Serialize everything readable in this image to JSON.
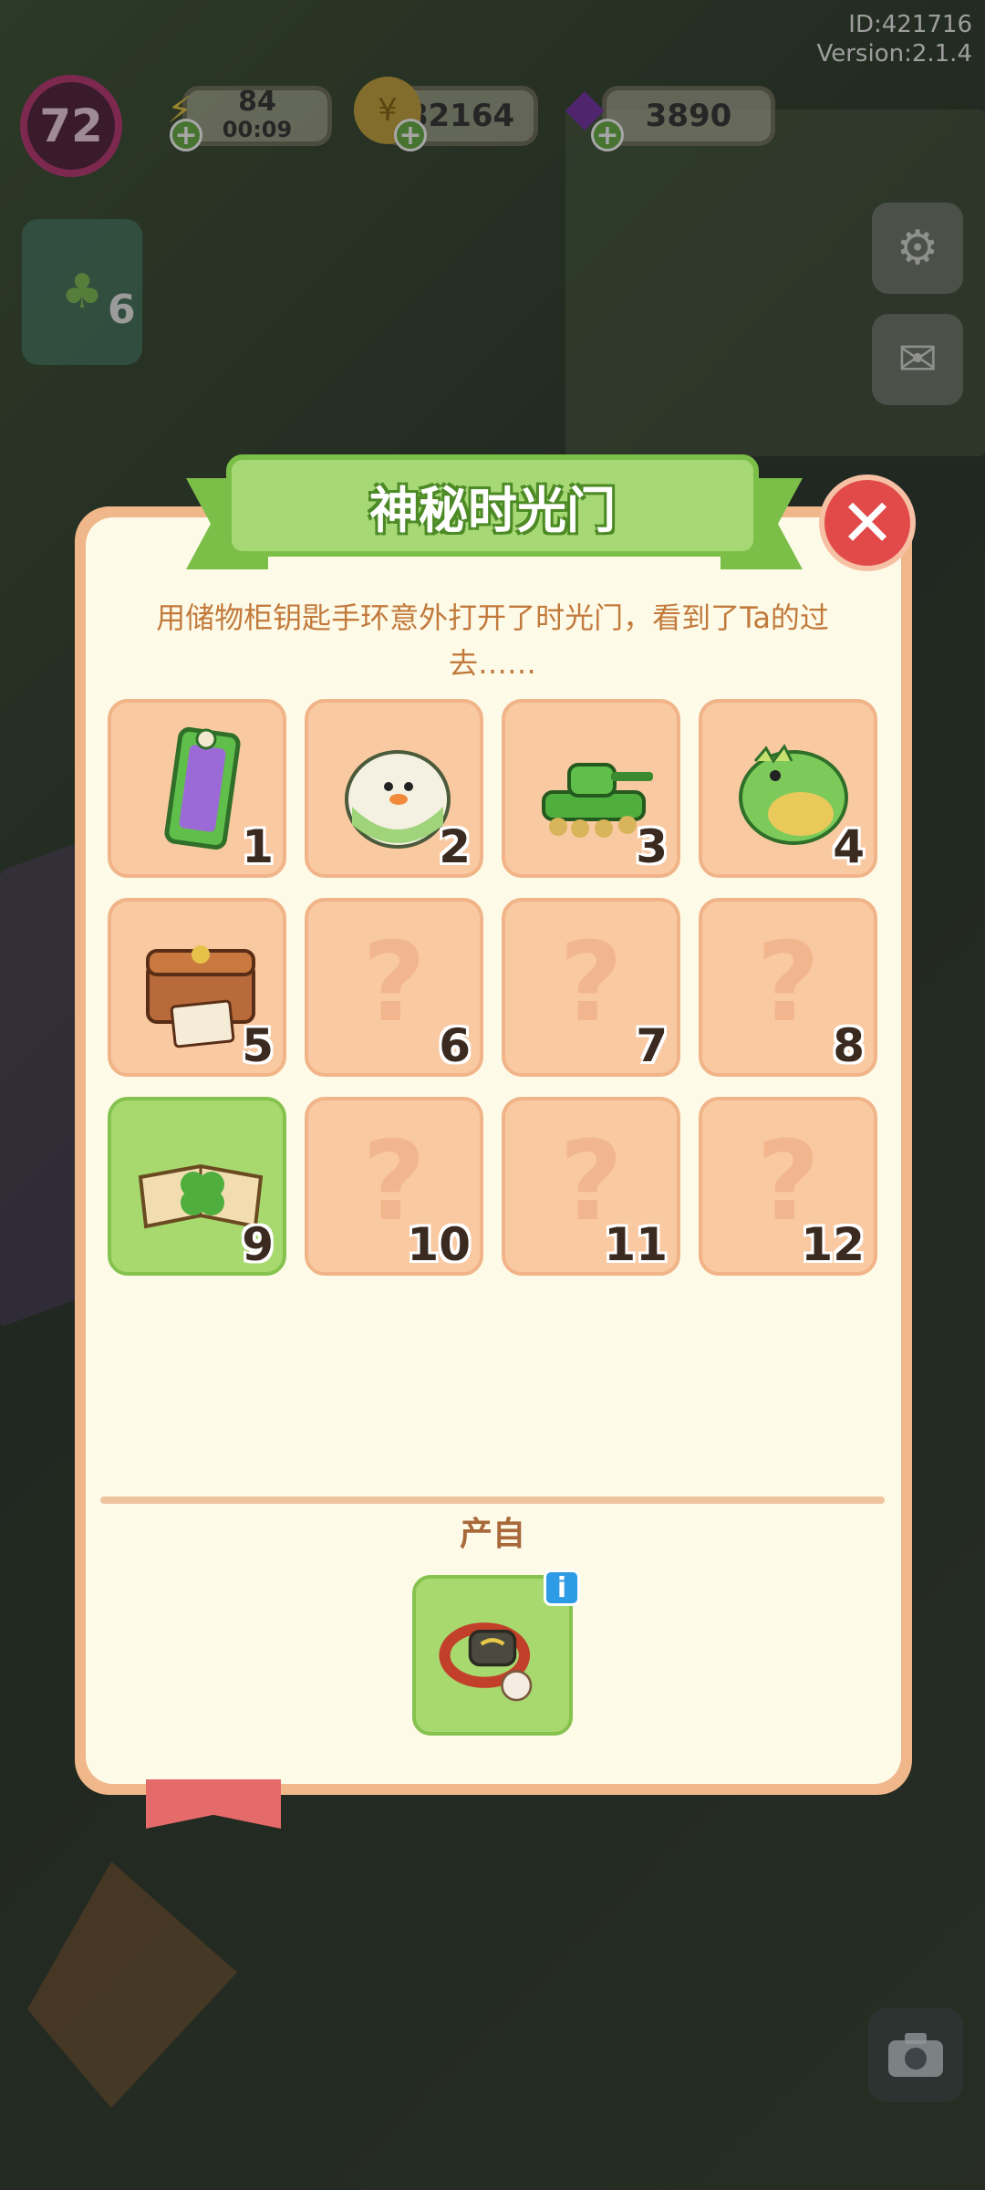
{
  "hud": {
    "id_text": "ID:421716",
    "version_text": "Version:2.1.4",
    "level": "72",
    "energy_value": "84",
    "energy_timer": "00:09",
    "coins": "82164",
    "gems": "3890",
    "side_counter": "6"
  },
  "modal": {
    "title": "神秘时光门",
    "description": "用储物柜钥匙手环意外打开了时光门，看到了Ta的过去……",
    "source_label": "产自",
    "close_icon": "close-icon",
    "items": [
      {
        "num": "1",
        "unlocked": true,
        "icon": "mirror-cabinet-icon"
      },
      {
        "num": "2",
        "unlocked": true,
        "icon": "duck-egg-icon"
      },
      {
        "num": "3",
        "unlocked": true,
        "icon": "toy-tank-icon"
      },
      {
        "num": "4",
        "unlocked": true,
        "icon": "dino-bag-icon"
      },
      {
        "num": "5",
        "unlocked": true,
        "icon": "treasure-chest-icon"
      },
      {
        "num": "6",
        "unlocked": false,
        "icon": "question-mark-icon"
      },
      {
        "num": "7",
        "unlocked": false,
        "icon": "question-mark-icon"
      },
      {
        "num": "8",
        "unlocked": false,
        "icon": "question-mark-icon"
      },
      {
        "num": "9",
        "unlocked": true,
        "selected": true,
        "icon": "clover-book-icon"
      },
      {
        "num": "10",
        "unlocked": false,
        "icon": "question-mark-icon"
      },
      {
        "num": "11",
        "unlocked": false,
        "icon": "question-mark-icon"
      },
      {
        "num": "12",
        "unlocked": false,
        "icon": "question-mark-icon"
      }
    ],
    "question_mark": "?",
    "source_icon": "locker-key-bracelet-icon",
    "info_badge": "i"
  },
  "colors": {
    "panel_border": "#f0b78a",
    "panel_fill": "#fdfbe8",
    "cell_locked": "#f9c9a1",
    "cell_selected": "#a8d96f",
    "banner": "#a7d876",
    "close": "#e24a4a",
    "desc_text": "#c27a3c"
  }
}
